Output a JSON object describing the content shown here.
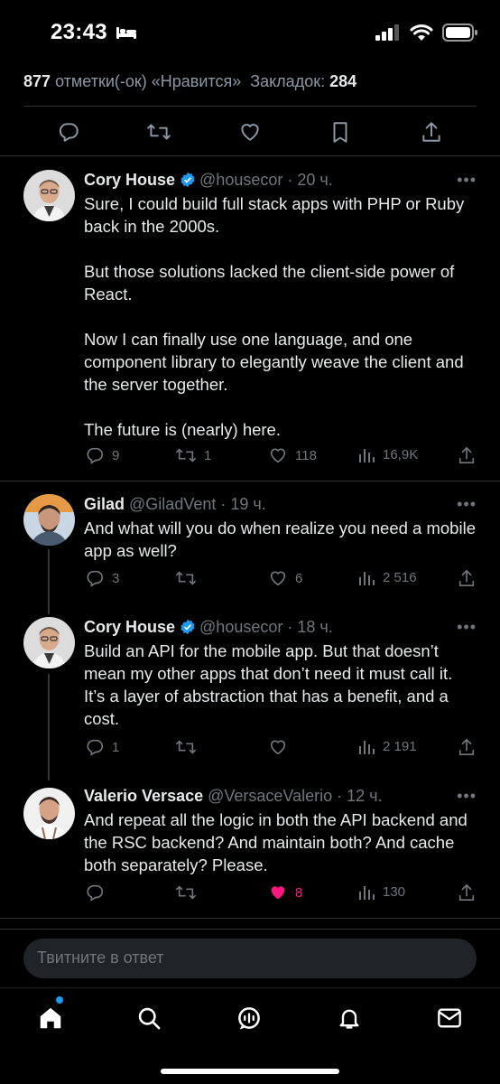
{
  "status_bar": {
    "time": "23:43"
  },
  "stats": {
    "likes_count": "877",
    "likes_label": "отметки(-ок) «Нравится»",
    "bookmarks_label": "Закладок:",
    "bookmarks_count": "284"
  },
  "tweets": [
    {
      "name": "Cory House",
      "verified": true,
      "handle": "@housecor",
      "time": "20 ч.",
      "text": "Sure, I could build full stack apps with PHP or Ruby back in the 2000s.\n\nBut those solutions lacked the client-side power of React.\n\nNow I can finally use one language, and one component library to elegantly weave the client and the server together.\n\nThe future is (nearly) here.",
      "replies": "9",
      "retweets": "1",
      "likes": "118",
      "views": "16,9K"
    },
    {
      "name": "Gilad",
      "verified": false,
      "handle": "@GiladVent",
      "time": "19 ч.",
      "text": "And what will you do when realize you need a mobile app as well?",
      "replies": "3",
      "retweets": "",
      "likes": "6",
      "views": "2 516"
    },
    {
      "name": "Cory House",
      "verified": true,
      "handle": "@housecor",
      "time": "18 ч.",
      "text": "Build an API for the mobile app. But that doesn’t mean my other apps that don’t need it must call it. It’s a layer of abstraction that has a benefit, and a cost.",
      "replies": "1",
      "retweets": "",
      "likes": "",
      "views": "2 191"
    },
    {
      "name": "Valerio Versace",
      "verified": false,
      "handle": "@VersaceValerio",
      "time": "12 ч.",
      "text": "And repeat all the logic in both the API backend and the RSC backend? And maintain both? And cache both separately? Please.",
      "replies": "",
      "retweets": "",
      "likes": "8",
      "views": "130",
      "liked": true
    }
  ],
  "reply_box": {
    "placeholder": "Твитните в ответ"
  },
  "icons": {
    "reply": "reply-icon",
    "retweet": "retweet-icon",
    "like": "heart-icon",
    "bookmark": "bookmark-icon",
    "share": "share-icon",
    "views": "views-icon",
    "home": "home-icon",
    "search": "search-icon",
    "spaces": "spaces-icon",
    "notifications": "bell-icon",
    "messages": "mail-icon"
  },
  "colors": {
    "background": "#000000",
    "text": "#e7e9ea",
    "muted": "#71767b",
    "accent": "#1d9bf0",
    "like": "#f91880",
    "verified": "#1d9bf0"
  }
}
